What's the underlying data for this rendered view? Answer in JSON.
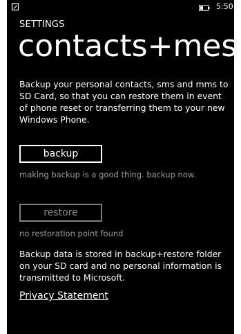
{
  "status_bar": {
    "time": "5:50"
  },
  "header": {
    "app_title": "SETTINGS",
    "page_title": "contacts+messages"
  },
  "main": {
    "description": "Backup your personal contacts, sms and mms to SD Card, so that you can restore them in event of phone reset or transferring them to your new Windows Phone.",
    "backup_button": "backup",
    "backup_hint": "making backup is a good thing. backup now.",
    "restore_button": "restore",
    "restore_hint": "no restoration point found",
    "info": "Backup data is stored in backup+restore folder on your SD card and no personal information is transmitted to Microsoft.",
    "privacy_link": "Privacy Statement"
  },
  "colors": {
    "background": "#000000",
    "foreground": "#ffffff",
    "disabled": "#7f7f7f",
    "subtle_text": "#9a9a9a"
  },
  "icons": {
    "status_left": "signal-settings-icon",
    "battery": "battery-icon"
  }
}
